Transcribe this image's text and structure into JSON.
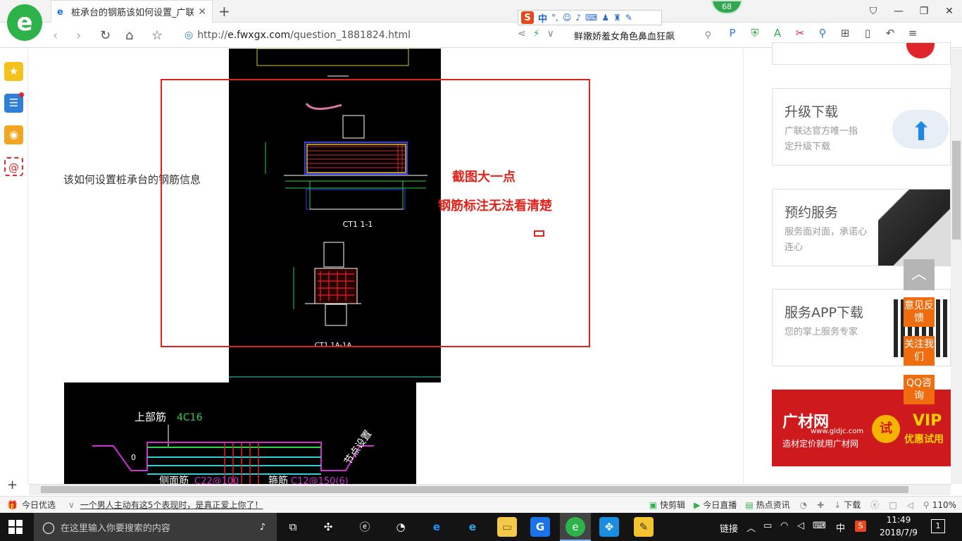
{
  "browser": {
    "tab_title": "桩承台的钢筋该如何设置_广联达",
    "url_prefix": "http://",
    "url_host": "e.fwxgx.com",
    "url_path": "/question_1881824.html",
    "search_query": "鲜嫩娇羞女角色鼻血狂飙",
    "score_badge": "68"
  },
  "ime": {
    "mode": "中",
    "punct": "°,"
  },
  "question": {
    "text": "该如何设置桩承台的钢筋信息"
  },
  "annotations": {
    "line1": "截图大一点",
    "line2": "钢筋标注无法看清楚"
  },
  "cad_labels": {
    "sec1": "CT1  1-1",
    "sec2": "CT1  1A-1A",
    "top_bar": "上部筋",
    "top_bar_spec": "4C16",
    "side_bar": "侧面筋",
    "side_bar_spec": "C22@100",
    "stirrup": "箍筋",
    "stirrup_spec": "C12@150(6)",
    "node": "节点设置",
    "dim_h": "0"
  },
  "right_cards": [
    {
      "title": "升级下载",
      "desc": "广联达官方唯一指定升级下载"
    },
    {
      "title": "预约服务",
      "desc": "服务面对面，承诺心连心"
    },
    {
      "title": "服务APP下载",
      "desc": "您的掌上服务专家"
    }
  ],
  "ad": {
    "brand": "广材网",
    "site": "www.gldjc.com",
    "slogan": "造材定价就用广材网",
    "try": "试",
    "vip": "VIP",
    "vip_sub": "优惠试用"
  },
  "float_buttons": [
    "意见反馈",
    "关注我们",
    "QQ咨询"
  ],
  "statusbar": {
    "today_pick": "今日优选",
    "headline": "一个男人主动有这5个表现时，是真正爱上你了！",
    "items": [
      "快剪辑",
      "今日直播",
      "热点资讯",
      "下载"
    ],
    "zoom": "110%"
  },
  "taskbar": {
    "search_placeholder": "在这里输入你要搜索的内容",
    "links": "链接",
    "ime": "中",
    "time": "11:49",
    "date": "2018/7/9",
    "notif_count": "1"
  }
}
